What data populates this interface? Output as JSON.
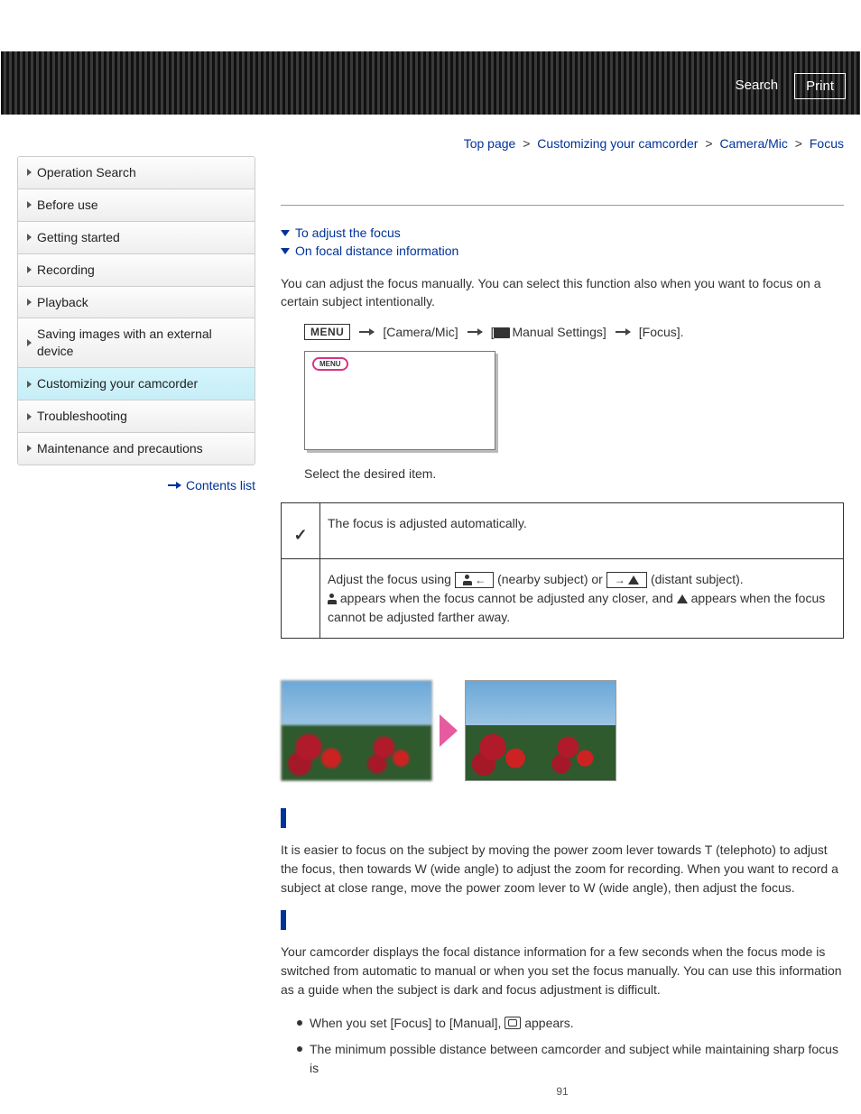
{
  "banner": {
    "search": "Search",
    "print": "Print"
  },
  "breadcrumb": {
    "top": "Top page",
    "custom": "Customizing your camcorder",
    "cammic": "Camera/Mic",
    "focus": "Focus",
    "sep": ">"
  },
  "sidebar": {
    "items": [
      {
        "label": "Operation Search"
      },
      {
        "label": "Before use"
      },
      {
        "label": "Getting started"
      },
      {
        "label": "Recording"
      },
      {
        "label": "Playback"
      },
      {
        "label": "Saving images with an external device"
      },
      {
        "label": "Customizing your camcorder"
      },
      {
        "label": "Troubleshooting"
      },
      {
        "label": "Maintenance and precautions"
      }
    ],
    "contents_list": "Contents list"
  },
  "anchors": {
    "adjust": "To adjust the focus",
    "focal": "On focal distance information"
  },
  "intro": "You can adjust the focus manually. You can select this function also when you want to focus on a certain subject intentionally.",
  "menu": {
    "menu_label": "MENU",
    "cammic": "[Camera/Mic]",
    "manual_prefix": "[",
    "manual": "Manual Settings]",
    "focus": "[Focus].",
    "preview_chip": "MENU"
  },
  "select_item": "Select the desired item.",
  "table": {
    "auto": "The focus is adjusted automatically.",
    "manual_pre": "Adjust the focus using ",
    "near_key_arrow": "←",
    "near_txt": " (nearby subject) or ",
    "far_key_arrow": "→",
    "far_txt": " (distant subject).",
    "line2a": " appears when the focus cannot be adjusted any closer, and ",
    "line2b": " appears when the focus cannot be adjusted farther away."
  },
  "section1": "It is easier to focus on the subject by moving the power zoom lever towards T (telephoto) to adjust the focus, then towards W (wide angle) to adjust the zoom for recording. When you want to record a subject at close range, move the power zoom lever to W (wide angle), then adjust the focus.",
  "section2": "Your camcorder displays the focal distance information for a few seconds when the focus mode is switched from automatic to manual or when you set the focus manually. You can use this information as a guide when the subject is dark and focus adjustment is difficult.",
  "notes": {
    "n1a": "When you set [Focus] to [Manual], ",
    "n1b": " appears.",
    "n2": "The minimum possible distance between camcorder and subject while maintaining sharp focus is"
  },
  "page_number": "91"
}
